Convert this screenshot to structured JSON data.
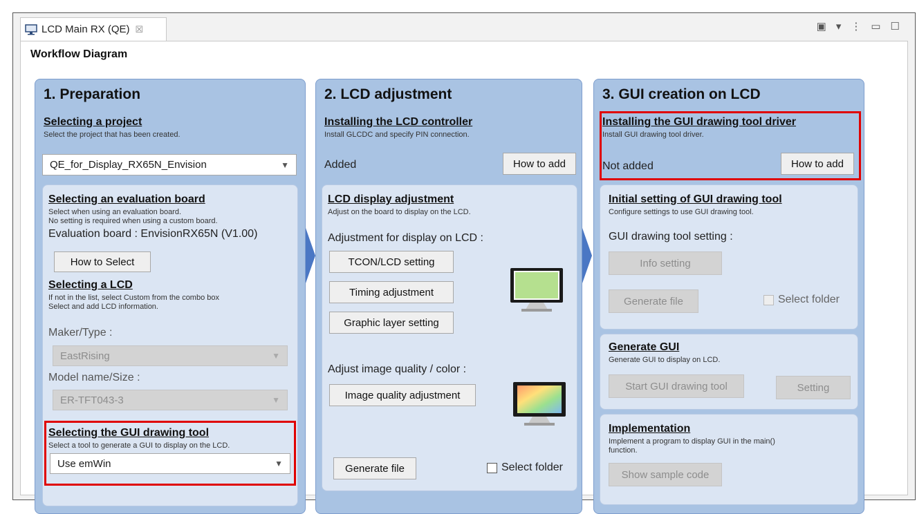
{
  "tab": {
    "title": "LCD Main RX (QE)",
    "close": "☒"
  },
  "view_tools": {
    "present": "▣",
    "dropdown": "▾",
    "menu": "⋮",
    "minimize": "▭",
    "maximize": "☐"
  },
  "workflow_title": "Workflow Diagram",
  "col1": {
    "title": "1. Preparation",
    "project": {
      "heading": "Selecting a project",
      "desc": "Select the project that has been created.",
      "selected": "QE_for_Display_RX65N_Envision"
    },
    "board": {
      "heading": "Selecting an evaluation board",
      "desc1": "Select when using an evaluation board.",
      "desc2": "No setting is required when using a custom board.",
      "value": "Evaluation board : EnvisionRX65N (V1.00)",
      "button": "How to Select"
    },
    "lcd": {
      "heading": "Selecting a LCD",
      "desc1": "If not in the list, select Custom from the combo box",
      "desc2": "Select and add LCD information.",
      "maker_label": "Maker/Type :",
      "maker_value": "EastRising",
      "model_label": "Model name/Size :",
      "model_value": "ER-TFT043-3"
    },
    "gui_tool": {
      "heading": "Selecting the GUI drawing tool",
      "desc": "Select a tool to generate a GUI to display on the LCD.",
      "selected": "Use emWin"
    }
  },
  "col2": {
    "title": "2. LCD adjustment",
    "controller": {
      "heading": "Installing the LCD controller",
      "desc": "Install GLCDC and specify PIN connection.",
      "status": "Added",
      "button": "How to add"
    },
    "display": {
      "heading": "LCD display adjustment",
      "desc": "Adjust on the board to display on the LCD.",
      "adjust_label": "Adjustment for display on LCD :",
      "btn_tcon": "TCON/LCD setting",
      "btn_timing": "Timing adjustment",
      "btn_graphic": "Graphic layer setting",
      "quality_label": "Adjust image quality / color :",
      "btn_quality": "Image quality adjustment",
      "btn_generate": "Generate file",
      "select_folder": "Select folder"
    }
  },
  "col3": {
    "title": "3. GUI creation on LCD",
    "driver": {
      "heading": "Installing the GUI drawing tool driver",
      "desc": "Install GUI drawing tool driver.",
      "status": "Not added",
      "button": "How to add"
    },
    "initial": {
      "heading": "Initial setting of GUI drawing tool",
      "desc": "Configure settings to use GUI drawing tool.",
      "setting_label": "GUI drawing tool setting :",
      "btn_info": "Info setting",
      "btn_generate": "Generate file",
      "select_folder": "Select folder"
    },
    "generate": {
      "heading": "Generate GUI",
      "desc": "Generate GUI to display on LCD.",
      "btn_start": "Start GUI drawing tool",
      "btn_setting": "Setting"
    },
    "implementation": {
      "heading": "Implementation",
      "desc1": "Implement a program to display GUI in the main()",
      "desc2": "function.",
      "btn_sample": "Show sample code"
    }
  },
  "colors": {
    "highlight": "#e00000",
    "arrow": "#4a77c4",
    "column_bg": "#a9c3e3",
    "panel_bg": "#dbe5f3"
  }
}
